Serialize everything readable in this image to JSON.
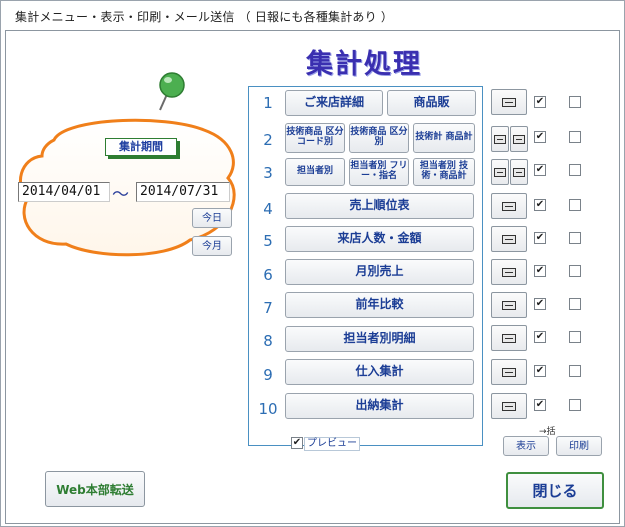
{
  "window": {
    "title": "集計メニュー・表示・印刷・メール送信 （ 日報にも各種集計あり ）"
  },
  "heading": "集計処理",
  "period": {
    "label": "集計期間",
    "start": "2014/04/01",
    "separator": "～",
    "end": "2014/07/31",
    "today_label": "今日",
    "month_label": "今月"
  },
  "menu": [
    {
      "num": "1",
      "buttons": [
        "ご来店詳細",
        "商品販"
      ],
      "preview_checked": true,
      "send_checked": false
    },
    {
      "num": "2",
      "buttons": [
        "技術商品 区分コード別",
        "技術商品 区分別",
        "技術計 商品計"
      ],
      "preview_checked": true,
      "send_checked": false
    },
    {
      "num": "3",
      "buttons": [
        "担当者別",
        "担当者別 フリー・指名",
        "担当者別 技術・商品計"
      ],
      "preview_checked": true,
      "send_checked": false
    },
    {
      "num": "4",
      "buttons": [
        "売上順位表"
      ],
      "preview_checked": true,
      "send_checked": false
    },
    {
      "num": "5",
      "buttons": [
        "来店人数・金額"
      ],
      "preview_checked": true,
      "send_checked": false
    },
    {
      "num": "6",
      "buttons": [
        "月別売上"
      ],
      "preview_checked": true,
      "send_checked": false
    },
    {
      "num": "7",
      "buttons": [
        "前年比較"
      ],
      "preview_checked": true,
      "send_checked": false
    },
    {
      "num": "8",
      "buttons": [
        "担当者別明細"
      ],
      "preview_checked": true,
      "send_checked": false
    },
    {
      "num": "9",
      "buttons": [
        "仕入集計"
      ],
      "preview_checked": true,
      "send_checked": false
    },
    {
      "num": "10",
      "buttons": [
        "出納集計"
      ],
      "preview_checked": true,
      "send_checked": false
    }
  ],
  "preview_checkbox": {
    "label": "プレビュー",
    "checked": true
  },
  "bulk": {
    "label": "→括",
    "show_label": "表示",
    "print_label": "印刷"
  },
  "web_button_label": "Web本部転送",
  "close_button_label": "閉じる",
  "icons": {
    "pin": "map-pin-icon",
    "preview": "preview-window-icon"
  },
  "colors": {
    "accent_blue": "#1b3d95",
    "heading": "#3a2fb0",
    "cloud_orange": "#f07f1a",
    "pin_green": "#4caf50",
    "number_blue": "#2c6db3"
  }
}
